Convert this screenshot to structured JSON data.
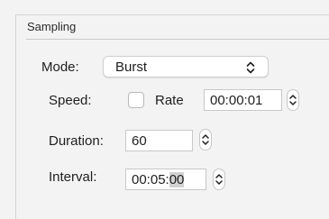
{
  "section": {
    "title": "Sampling"
  },
  "mode": {
    "label": "Mode:",
    "value": "Burst"
  },
  "speed": {
    "label": "Speed:",
    "rate_label": "Rate",
    "rate_checked": false,
    "rate_value": "00:00:01"
  },
  "duration": {
    "label": "Duration:",
    "value": "60"
  },
  "interval": {
    "label": "Interval:",
    "value_prefix": "00:05:",
    "value_selected": "00"
  },
  "icons": {
    "popup": "chevron-up-down-icon",
    "stepper": "stepper-arrows-icon"
  }
}
